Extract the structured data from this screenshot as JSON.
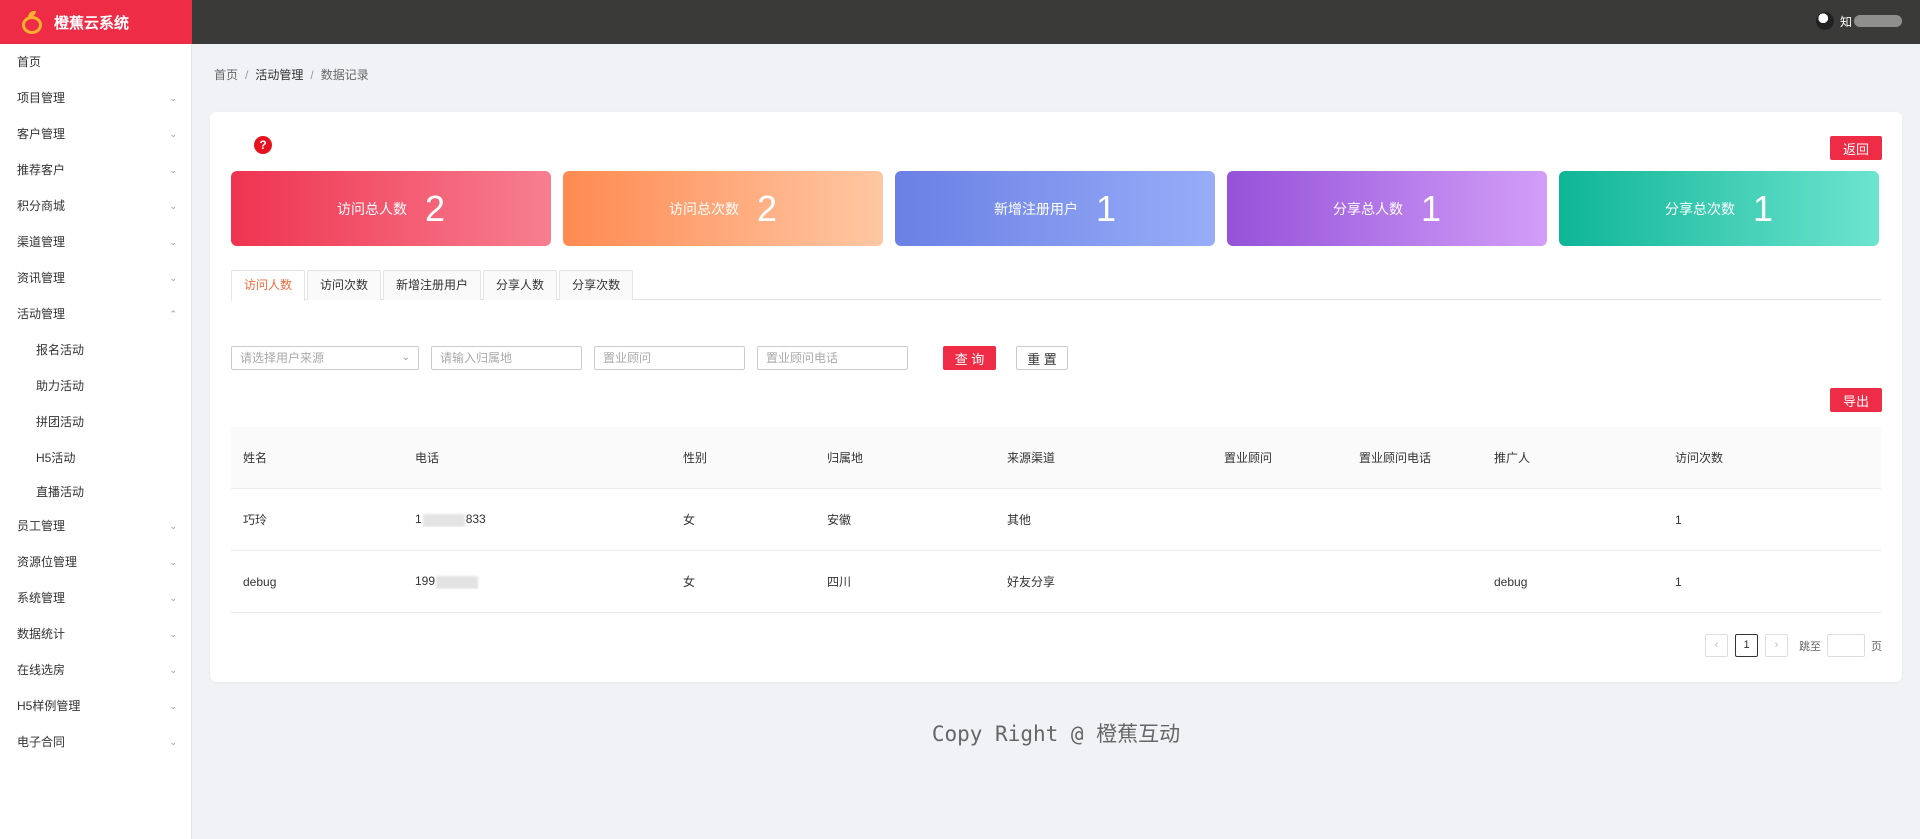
{
  "header": {
    "logo_text": "橙蕉云系统",
    "user_name": "知"
  },
  "sidebar": {
    "items": [
      {
        "label": "首页",
        "has_children": false
      },
      {
        "label": "项目管理",
        "chevron": "⌄"
      },
      {
        "label": "客户管理",
        "chevron": "⌄"
      },
      {
        "label": "推荐客户",
        "chevron": "⌄"
      },
      {
        "label": "积分商城",
        "chevron": "⌄"
      },
      {
        "label": "渠道管理",
        "chevron": "⌄"
      },
      {
        "label": "资讯管理",
        "chevron": "⌄"
      },
      {
        "label": "活动管理",
        "chevron": "⌃",
        "expanded": true
      },
      {
        "label": "报名活动",
        "sub": true
      },
      {
        "label": "助力活动",
        "sub": true
      },
      {
        "label": "拼团活动",
        "sub": true
      },
      {
        "label": "H5活动",
        "sub": true
      },
      {
        "label": "直播活动",
        "sub": true
      },
      {
        "label": "员工管理",
        "chevron": "⌄"
      },
      {
        "label": "资源位管理",
        "chevron": "⌄"
      },
      {
        "label": "系统管理",
        "chevron": "⌄"
      },
      {
        "label": "数据统计",
        "chevron": "⌄"
      },
      {
        "label": "在线选房",
        "chevron": "⌄"
      },
      {
        "label": "H5样例管理",
        "chevron": "⌄"
      },
      {
        "label": "电子合同",
        "chevron": "⌄"
      }
    ]
  },
  "breadcrumb": {
    "home": "首页",
    "sep": "/",
    "parent": "活动管理",
    "current": "数据记录"
  },
  "actions": {
    "help": "?",
    "back": "返回",
    "export": "导出"
  },
  "stats": [
    {
      "label": "访问总人数",
      "value": "2"
    },
    {
      "label": "访问总次数",
      "value": "2"
    },
    {
      "label": "新增注册用户",
      "value": "1"
    },
    {
      "label": "分享总人数",
      "value": "1"
    },
    {
      "label": "分享总次数",
      "value": "1"
    }
  ],
  "tabs": [
    "访问人数",
    "访问次数",
    "新增注册用户",
    "分享人数",
    "分享次数"
  ],
  "filters": {
    "source_placeholder": "请选择用户来源",
    "location_placeholder": "请输入归属地",
    "advisor_placeholder": "置业顾问",
    "advisor_phone_placeholder": "置业顾问电话",
    "query": "查 询",
    "reset": "重 置"
  },
  "table": {
    "headers": [
      "姓名",
      "电话",
      "性别",
      "归属地",
      "来源渠道",
      "置业顾问",
      "置业顾问电话",
      "推广人",
      "访问次数"
    ],
    "rows": [
      {
        "name": "巧玲",
        "phone_prefix": "1",
        "phone_suffix": "833",
        "gender": "女",
        "location": "安徽",
        "channel": "其他",
        "advisor": "",
        "advisor_phone": "",
        "promoter": "",
        "visits": "1"
      },
      {
        "name": "debug",
        "phone_prefix": "199",
        "phone_suffix": "",
        "gender": "女",
        "location": "四川",
        "channel": "好友分享",
        "advisor": "",
        "advisor_phone": "",
        "promoter": "debug",
        "visits": "1"
      }
    ]
  },
  "pagination": {
    "prev": "‹",
    "current": "1",
    "next": "›",
    "jump_label": "跳至",
    "page_unit": "页"
  },
  "footer": {
    "text": "Copy Right @ 橙蕉互动"
  }
}
